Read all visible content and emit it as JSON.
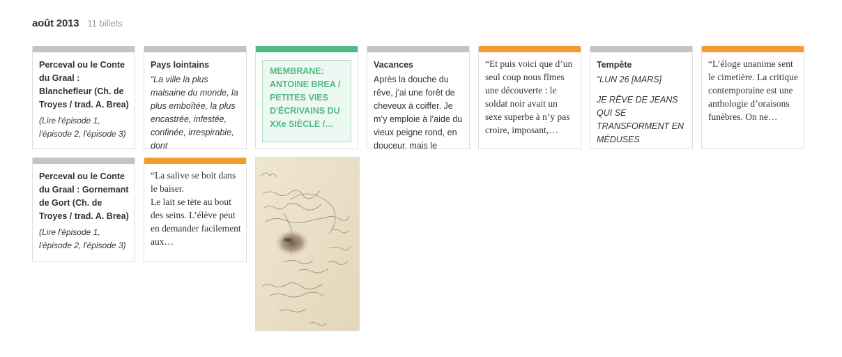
{
  "header": {
    "month": "août 2013",
    "count": "11 billets"
  },
  "colors": {
    "gray": "#c4c4c4",
    "orange": "#f39b2b",
    "green": "#4fba82"
  },
  "cards": [
    {
      "title": "Perceval ou le Conte du Graal : Blanchefleur (Ch. de Troyes / trad. A. Brea)",
      "excerpt": "(Lire l'épisode 1, l'épisode 2, l'épisode 3)"
    },
    {
      "title": "Pays lointains",
      "excerpt": "“La ville la plus malsaine du monde, la plus emboîtée, la plus encastrée, infestée, confinée, irrespirable, dont"
    },
    {
      "text": "MEMBRANE: ANTOINE BREA / PETITES VIES D'ÉCRIVAINS DU XXe SIÈCLE /…"
    },
    {
      "title": "Vacances",
      "excerpt": "Après la douche du rêve, j’ai une forêt de cheveux à coiffer. Je m’y emploie à l’aide du vieux peigne rond, en douceur, mais le"
    },
    {
      "text": "“Et puis voici que d’un seul coup nous fîmes une découverte : le soldat noir avait un sexe superbe à n’y pas croire, imposant,…"
    },
    {
      "title": "Tempête",
      "line1": "“LUN 26 [MARS]",
      "line2": "JE RÊVE DE JEANS QUI SE TRANSFORMENT EN MÉDUSES"
    },
    {
      "text": "“L’éloge unanime sent le cimetière. La critique contemporaine est une anthologie d’oraisons funèbres. On ne…"
    },
    {
      "title": "Perceval ou le Conte du Graal : Gornemant de Gort (Ch. de Troyes / trad. A. Brea)",
      "excerpt": "(Lire l'épisode 1, l'épisode 2, l'épisode 3)"
    },
    {
      "text": "“La salive se boit dans le baiser.\nLe lait se tète au bout des seins. L’élève peut en demander facilement aux…"
    },
    {
      "image": "handwritten-letter-with-face-sketch"
    }
  ]
}
